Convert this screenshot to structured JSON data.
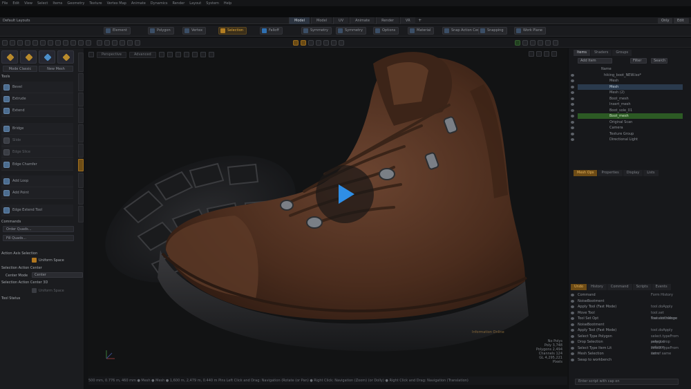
{
  "menu": [
    "File",
    "Edit",
    "View",
    "Select",
    "Items",
    "Geometry",
    "Texture",
    "Vertex Map",
    "Animate",
    "Dynamics",
    "Render",
    "Layout",
    "System",
    "Help"
  ],
  "layout_label": "Default Layouts",
  "workspace_tabs": [
    {
      "label": "Model",
      "active": true
    },
    {
      "label": "Model",
      "active": false
    },
    {
      "label": "UV",
      "active": false
    },
    {
      "label": "Animate",
      "active": false
    },
    {
      "label": "Render",
      "active": false
    },
    {
      "label": "VR",
      "active": false
    }
  ],
  "workspace_add": "+",
  "window_controls": {
    "left": "Only",
    "right": "Edit"
  },
  "toolbar": {
    "items": [
      "Element",
      "Polygon",
      "Vertex",
      "Selection",
      "Falloff",
      "Symmetry",
      "Symmetry",
      "Options",
      "Material",
      "Snap Action Center",
      "Snapping",
      "Work Plane"
    ],
    "accent_index": 3
  },
  "left_panel": {
    "mode_buttons": [
      "Mode Classic",
      "New Mesh"
    ],
    "sections": {
      "tools": "Tools",
      "commands": "Commands",
      "action_axis": "Action Axis Selection",
      "action_center": "Selection Action Center",
      "action_center_3d": "Selection Action Center 3D",
      "tool_status": "Tool Status"
    },
    "tools": [
      {
        "label": "Bevel",
        "dim": false
      },
      {
        "label": "Extrude",
        "dim": false
      },
      {
        "label": "Extend",
        "dim": false
      },
      {
        "label": "Bridge",
        "dim": false
      },
      {
        "label": "Slide",
        "dim": true
      },
      {
        "label": "Edge Slice",
        "dim": true
      },
      {
        "label": "Edge Chamfer",
        "dim": false
      },
      {
        "label": "Add Loop",
        "dim": false
      },
      {
        "label": "Add Point",
        "dim": false
      },
      {
        "label": "Edge Extend Tool",
        "dim": false
      }
    ],
    "commands": [
      "Order Quads...",
      "Fill Quads..."
    ],
    "uniform_space_label": "Uniform Space",
    "center_mode_label": "Center Mode",
    "center_mode_value": "Center",
    "uniform_space_3d_label": "Uniform Space"
  },
  "viewport": {
    "view_type": "Perspective",
    "shading": "Advanced",
    "status": "500 mm, 0.776 m, 460 mm  ● Mesh ● Mesh ● 1,600 m, 2,479 m, 0.440 m      Pins      Left Click and Drag: Navigation (Rotate (or Pan)  ● Right Click: Navigation (Zoom) (or Dolly)  ● Right Click and Drag: Navigation (Translation)",
    "overlay_hint": "Information Online",
    "corner_stats": [
      "No Polys",
      "Poly 3,748",
      "Polygons 2,494",
      "Channels 124",
      "GL 4,295,221",
      "Pixels"
    ]
  },
  "right_panel": {
    "top_tabs": [
      "Items",
      "Shaders",
      "Groups"
    ],
    "add_label": "Add Item",
    "filter_label": "Filter",
    "search_label": "Search",
    "outline": [
      {
        "label": "Name",
        "style": "head"
      },
      {
        "label": "hiking_boot_NEW.lxo*",
        "style": "normal"
      },
      {
        "label": "Mesh",
        "style": "normal"
      },
      {
        "label": "Mesh",
        "style": "sel"
      },
      {
        "label": "Mesh (2)",
        "style": "normal"
      },
      {
        "label": "Boot_mesh",
        "style": "normal"
      },
      {
        "label": "Insert_mesh",
        "style": "normal"
      },
      {
        "label": "Boot_sole_01",
        "style": "normal"
      },
      {
        "label": "Boot_mesh",
        "style": "grn"
      },
      {
        "label": "Original Scan",
        "style": "normal"
      },
      {
        "label": "Camera",
        "style": "normal"
      },
      {
        "label": "Texture Group",
        "style": "normal"
      },
      {
        "label": "Directional Light",
        "style": "normal"
      }
    ],
    "mid_tabs": [
      "Mesh Ops",
      "Properties",
      "Display",
      "Lists"
    ],
    "bottom_tabs": [
      "Undo",
      "History",
      "Command",
      "Scripts",
      "Events"
    ],
    "commands": [
      {
        "name": "Command",
        "value": "Form History"
      },
      {
        "name": "NoiseBootment",
        "value": ""
      },
      {
        "name": "Apply Tool (Fast Mode)",
        "value": "tool.doApply"
      },
      {
        "name": "Move Tool",
        "value": "tool.set TransformMove"
      },
      {
        "name": "Tool Set Opt",
        "value": "tool.setChange"
      },
      {
        "name": "NoiseBootment",
        "value": ""
      },
      {
        "name": "Apply Tool (Fast Mode)",
        "value": "tool.doApply"
      },
      {
        "name": "Select Type Polygon",
        "value": "select.typeFrom polygon"
      },
      {
        "name": "Drop Selection",
        "value": "select.drop polygon"
      },
      {
        "name": "Select Type Item Lit",
        "value": "select.typeFrom item"
      },
      {
        "name": "Mesh Selection",
        "value": "set of same"
      },
      {
        "name": "Swap to workbench",
        "value": ""
      }
    ],
    "command_input": "Enter script with cap on"
  },
  "colors": {
    "accent": "#c8882a",
    "selection": "#2a3a4d",
    "highlight_green": "#2c5a24",
    "play": "#2f8ee6"
  }
}
